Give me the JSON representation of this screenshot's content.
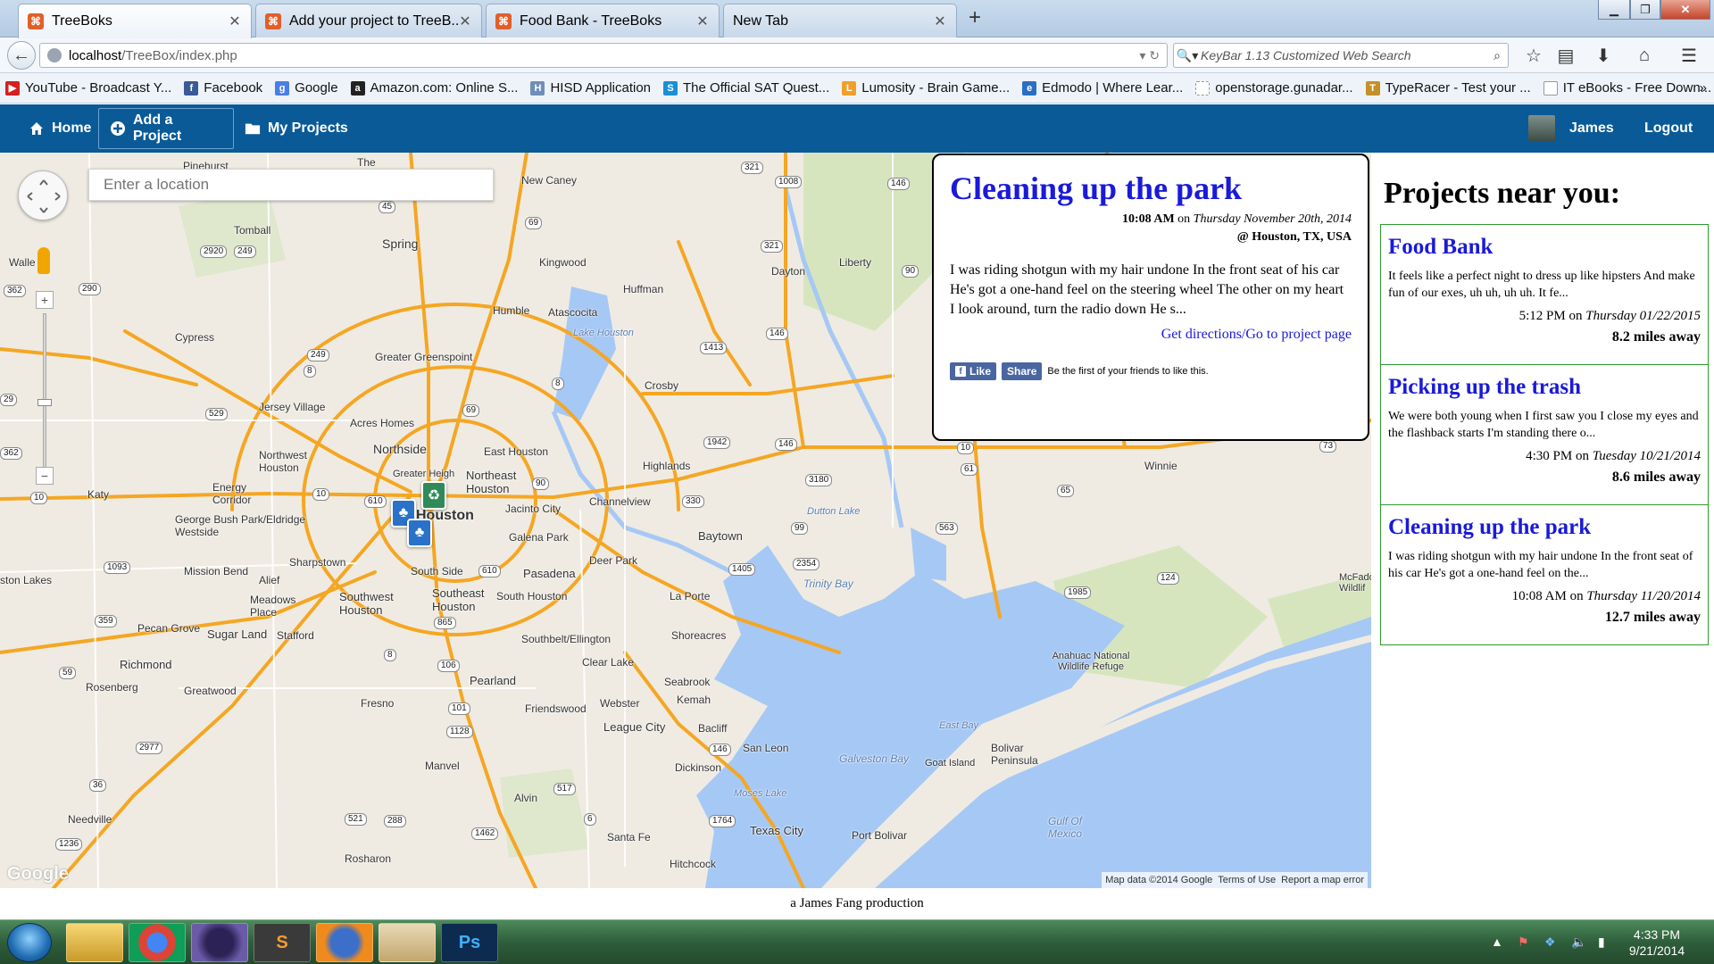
{
  "browser": {
    "tabs": [
      {
        "label": "TreeBoks",
        "close": "✕"
      },
      {
        "label": "Add your project to TreeB...",
        "close": "✕"
      },
      {
        "label": "Food Bank - TreeBoks",
        "close": "✕"
      },
      {
        "label": "New Tab",
        "close": "✕"
      }
    ],
    "new_tab": "+",
    "url_host": "localhost",
    "url_path": "/TreeBox/index.php",
    "search_placeholder": "KeyBar 1.13 Customized Web Search",
    "bookmarks": [
      {
        "label": "YouTube - Broadcast Y...",
        "color": "#d61f1f",
        "glyph": "▶"
      },
      {
        "label": "Facebook",
        "color": "#3b5998",
        "glyph": "f"
      },
      {
        "label": "Google",
        "color": "#4a7de8",
        "glyph": "g"
      },
      {
        "label": "Amazon.com: Online S...",
        "color": "#222222",
        "glyph": "a"
      },
      {
        "label": "HISD Application",
        "color": "#6f8fb8",
        "glyph": "H"
      },
      {
        "label": "The Official SAT Quest...",
        "color": "#1b8fd6",
        "glyph": "S"
      },
      {
        "label": "Lumosity - Brain Game...",
        "color": "#f0a02a",
        "glyph": "L"
      },
      {
        "label": "Edmodo | Where Lear...",
        "color": "#2b6fc2",
        "glyph": "e"
      },
      {
        "label": "openstorage.gunadar...",
        "color": "#bbbbbb",
        "glyph": ""
      },
      {
        "label": "TypeRacer - Test your ...",
        "color": "#c4902a",
        "glyph": "T"
      },
      {
        "label": "IT eBooks - Free Down...",
        "color": "#bbbbbb",
        "glyph": ""
      }
    ],
    "bookmarks_more": "»"
  },
  "site_nav": {
    "home": "Home",
    "add_project": "Add a Project",
    "my_projects": "My Projects",
    "user": "James",
    "logout": "Logout"
  },
  "map": {
    "search_placeholder": "Enter a location",
    "attribution": [
      "Map data ©2014 Google",
      "Terms of Use",
      "Report a map error"
    ],
    "google_logo": "Google",
    "labels": [
      "Pinehurst",
      "The",
      "Tomball",
      "Spring",
      "Cypress",
      "Katy",
      "Humble",
      "Atascocita",
      "Kingwood",
      "New Caney",
      "Huffman",
      "Dayton",
      "Liberty",
      "Crosby",
      "Greater Greenspoint",
      "Jersey Village",
      "Acres Homes",
      "Northside",
      "Northwest Houston",
      "East Houston",
      "Northeast Houston",
      "Energy Corridor",
      "George Bush Park/Eldridge Westside",
      "Houston",
      "Jacinto City",
      "Galena Park",
      "Channelview",
      "Highlands",
      "Baytown",
      "Sharpstown",
      "Alief",
      "Mission Bend",
      "South Side",
      "Pasadena",
      "Deer Park",
      "La Porte",
      "Southwest Houston",
      "Southeast Houston",
      "South Houston",
      "Meadows Place",
      "Sugar Land",
      "Stafford",
      "Pecan Grove",
      "Richmond",
      "Rosenberg",
      "Greatwood",
      "Fresno",
      "Pearland",
      "Southbelt/Ellington",
      "Clear Lake",
      "Shoreacres",
      "Seabrook",
      "Kemah",
      "Webster",
      "Friendswood",
      "League City",
      "Bacliff",
      "San Leon",
      "Dickinson",
      "Manvel",
      "Alvin",
      "Texas City",
      "Santa Fe",
      "Hitchcock",
      "Needville",
      "Rosharon",
      "Port Bolivar",
      "Bolivar Peninsula",
      "Goat Island",
      "Winnie",
      "Anahuac National Wildlife Refuge",
      "McFadd Wildlif",
      "Walle",
      "ston Lakes",
      "Greater Heigh"
    ],
    "water_labels": [
      "Lake Houston",
      "Dutton Lake",
      "Trinity Bay",
      "East Bay",
      "Galveston Bay",
      "Moses Lake",
      "Gulf Of Mexico"
    ],
    "highways": [
      "321",
      "1008",
      "146",
      "321",
      "90",
      "45",
      "69",
      "2920",
      "249",
      "362",
      "290",
      "249",
      "8",
      "1413",
      "146",
      "8",
      "529",
      "69",
      "1942",
      "146",
      "10",
      "61",
      "10",
      "10",
      "610",
      "90",
      "3180",
      "65",
      "73",
      "330",
      "99",
      "563",
      "1093",
      "610",
      "2354",
      "1405",
      "124",
      "359",
      "865",
      "1985",
      "59",
      "8",
      "106",
      "2977",
      "1128",
      "101",
      "517",
      "146",
      "36",
      "521",
      "288",
      "6",
      "1462",
      "1764",
      "1236",
      "29",
      "362"
    ]
  },
  "info_window": {
    "title": "Cleaning up the park",
    "time": "10:08 AM",
    "on": " on ",
    "date": "Thursday November 20th, 2014",
    "location": "@ Houston, TX, USA",
    "description": "I was riding shotgun with my hair undone In the front seat of his car He's got a one-hand feel on the steering wheel The other on my heart I look around, turn the radio down He s...",
    "link": "Get directions/Go to project page",
    "fb_like": "Like",
    "fb_share": "Share",
    "fb_text": "Be the first of your friends to like this."
  },
  "sidebar": {
    "heading": "Projects near you:",
    "projects": [
      {
        "title": "Food Bank",
        "description": "It feels like a perfect night to dress up like hipsters And make fun of our exes, uh uh, uh uh. It fe...",
        "time": "5:12 PM",
        "date": "Thursday 01/22/2015",
        "distance": "8.2 miles away"
      },
      {
        "title": "Picking up the trash",
        "description": "We were both young when I first saw you I close my eyes and the flashback starts I'm standing there o...",
        "time": "4:30 PM",
        "date": "Tuesday 10/21/2014",
        "distance": "8.6 miles away"
      },
      {
        "title": "Cleaning up the park",
        "description": "I was riding shotgun with my hair undone In the front seat of his car He's got a one-hand feel on the...",
        "time": "10:08 AM",
        "date": "Thursday 11/20/2014",
        "distance": "12.7 miles away"
      }
    ],
    "on": " on "
  },
  "footer": "a James Fang production",
  "taskbar": {
    "apps": [
      "folder-icon",
      "chrome-icon",
      "eclipse-icon",
      "sublime-icon",
      "firefox-icon",
      "paint-icon",
      "photoshop-icon"
    ],
    "app_glyphs": [
      "",
      "",
      "",
      "S",
      "",
      "",
      "Ps"
    ],
    "clock_time": "4:33 PM",
    "clock_date": "9/21/2014"
  },
  "colors": {
    "site_nav": "#0a5a98",
    "link_blue": "#1a1ad8",
    "card_border": "#2d9a2d",
    "water": "#a6c8f5",
    "road_orange": "#f5a623"
  }
}
